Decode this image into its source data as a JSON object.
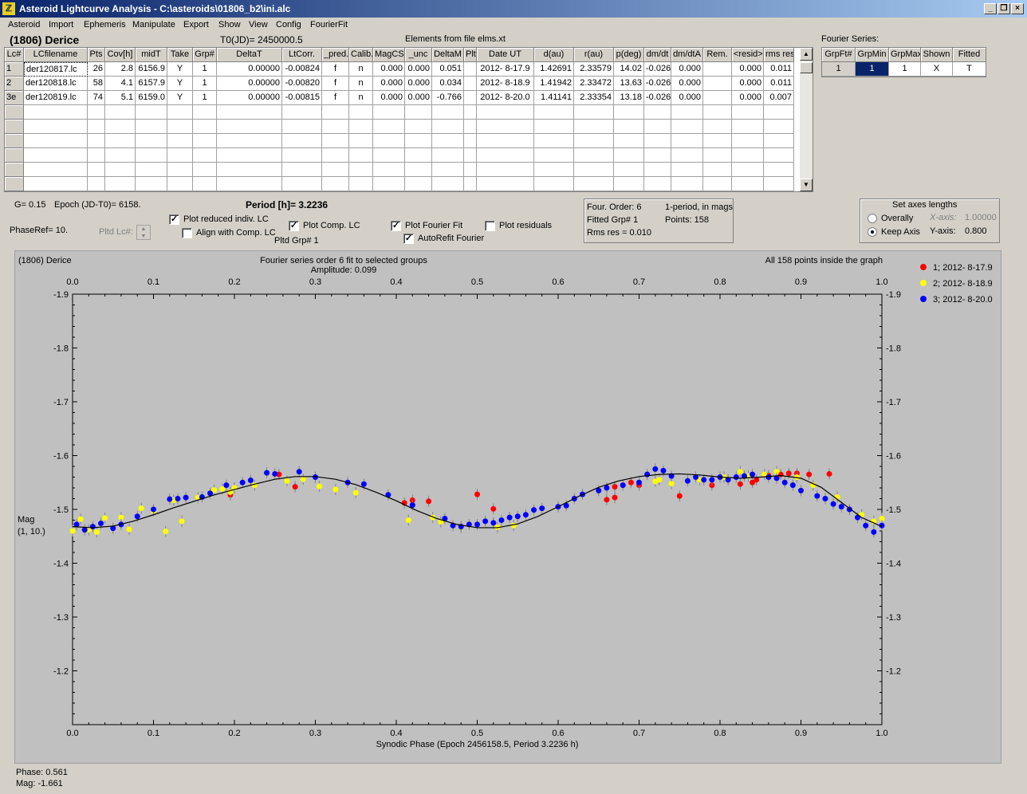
{
  "window": {
    "title": "Asteroid Lightcurve Analysis - C:\\asteroids\\01806_b2\\ini.alc",
    "icon_char": "ℤ"
  },
  "menu": [
    "Asteroid",
    "Import",
    "Ephemeris",
    "Manipulate",
    "Export",
    "Show",
    "View",
    "Config",
    "FourierFit"
  ],
  "header": {
    "asteroid": "(1806) Derice",
    "t0": "T0(JD)= 2450000.5",
    "elements": "Elements from file elms.xt",
    "fourier_series_label": "Fourier Series:"
  },
  "lc_table": {
    "columns": [
      "Lc#",
      "LCfilename",
      "Pts",
      "Cov[h]",
      "midT",
      "Take",
      "Grp#",
      "DeltaT",
      "LtCorr.",
      "_pred.",
      "Calib.",
      "MagCS",
      "_unc",
      "DeltaM",
      "Plt",
      "Date UT",
      "d(au)",
      "r(au)",
      "p(deg)",
      "dm/dt",
      "dm/dtA",
      "Rem.",
      "<resid>",
      "rms res"
    ],
    "rows": [
      [
        "1",
        "der120817.lc",
        "26",
        "2.8",
        "6156.9",
        "Y",
        "1",
        "0.00000",
        "-0.00824",
        "f",
        "n",
        "0.000",
        "0.000",
        "0.051",
        "",
        "2012- 8-17.9",
        "1.42691",
        "2.33579",
        "14.02",
        "-0.026",
        "0.000",
        "",
        "0.000",
        "0.011"
      ],
      [
        "2",
        "der120818.lc",
        "58",
        "4.1",
        "6157.9",
        "Y",
        "1",
        "0.00000",
        "-0.00820",
        "f",
        "n",
        "0.000",
        "0.000",
        "0.034",
        "",
        "2012- 8-18.9",
        "1.41942",
        "2.33472",
        "13.63",
        "-0.026",
        "0.000",
        "",
        "0.000",
        "0.011"
      ],
      [
        "3e",
        "der120819.lc",
        "74",
        "5.1",
        "6159.0",
        "Y",
        "1",
        "0.00000",
        "-0.00815",
        "f",
        "n",
        "0.000",
        "0.000",
        "-0.766",
        "",
        "2012- 8-20.0",
        "1.41141",
        "2.33354",
        "13.18",
        "-0.026",
        "0.000",
        "",
        "0.000",
        "0.007"
      ]
    ]
  },
  "fourier_table": {
    "columns": [
      "GrpFt#",
      "GrpMin",
      "GrpMax",
      "Shown",
      "Fitted"
    ],
    "rows": [
      [
        "1",
        "1",
        "1",
        "X",
        "T"
      ]
    ]
  },
  "controls": {
    "g": "G= 0.15",
    "epoch": "Epoch (JD-T0)= 6158.",
    "period": "Period [h]= 3.2236",
    "phaseref": "PhaseRef= 10.",
    "pltd_lc": "Pltd Lc#:",
    "plot_reduced": "Plot reduced indiv. LC",
    "align_comp": "Align with Comp. LC",
    "plot_comp": "Plot Comp. LC",
    "pltd_grp": "Pltd Grp#  1",
    "plot_fourier": "Plot Fourier Fit",
    "autorefit": "AutoRefit Fourier",
    "plot_residuals": "Plot residuals",
    "four_order": "Four. Order:  6",
    "one_period": "1-period, in mags",
    "fitted_grp": "Fitted Grp# 1",
    "points": "Points: 158",
    "rms_res": "Rms res      = 0.010",
    "set_axes": "Set axes lengths",
    "overally": "Overally",
    "keep_axis": "Keep Axis",
    "x_axis_label": "X-axis:",
    "x_axis_value": "1.00000",
    "y_axis_label": "Y-axis:",
    "y_axis_value": "0.800"
  },
  "plot_labels": {
    "name": "(1806) Derice",
    "subtitle": "Fourier series order 6 fit to selected groups",
    "amplitude": "Amplitude: 0.099",
    "inside": "All 158 points inside the graph",
    "ylabel1": "Mag",
    "ylabel2": "(1, 10.)"
  },
  "status": {
    "phase": "Phase:  0.561",
    "mag": "Mag:    -1.661"
  },
  "colors": {
    "red": "#ff0000",
    "yellow": "#ffff00",
    "blue": "#0000ff",
    "plot_bg": "#c0c0c0",
    "titlebar": "#0a246a"
  },
  "chart_data": {
    "type": "scatter",
    "xlabel": "Synodic Phase (Epoch 2456158.5, Period 3.2236 h)",
    "ylabel": "Mag",
    "xlim": [
      0,
      1
    ],
    "ylim": [
      -1.9,
      -1.1
    ],
    "x_ticks": [
      "0.0",
      "0.1",
      "0.2",
      "0.3",
      "0.4",
      "0.5",
      "0.6",
      "0.7",
      "0.8",
      "0.9",
      "1.0"
    ],
    "y_ticks": [
      "-1.9",
      "-1.8",
      "-1.7",
      "-1.6",
      "-1.5",
      "-1.4",
      "-1.3",
      "-1.2"
    ],
    "series": [
      {
        "name": "1; 2012- 8-17.9",
        "color": "#ff0000",
        "x": [
          0.195,
          0.255,
          0.275,
          0.41,
          0.42,
          0.44,
          0.5,
          0.52,
          0.66,
          0.67,
          0.67,
          0.69,
          0.7,
          0.75,
          0.79,
          0.825,
          0.84,
          0.845,
          0.86,
          0.875,
          0.885,
          0.895,
          0.91,
          0.935
        ],
        "y": [
          -1.527,
          -1.565,
          -1.542,
          -1.512,
          -1.517,
          -1.515,
          -1.528,
          -1.501,
          -1.518,
          -1.522,
          -1.542,
          -1.55,
          -1.545,
          -1.525,
          -1.545,
          -1.547,
          -1.55,
          -1.555,
          -1.563,
          -1.565,
          -1.567,
          -1.567,
          -1.565,
          -1.566
        ]
      },
      {
        "name": "2; 2012- 8-18.9",
        "color": "#ffff00",
        "x": [
          0.0,
          0.01,
          0.02,
          0.03,
          0.04,
          0.06,
          0.07,
          0.085,
          0.1,
          0.115,
          0.125,
          0.135,
          0.155,
          0.175,
          0.185,
          0.195,
          0.2,
          0.225,
          0.265,
          0.285,
          0.305,
          0.325,
          0.35,
          0.415,
          0.445,
          0.455,
          0.48,
          0.525,
          0.545,
          0.72,
          0.725,
          0.74,
          0.775,
          0.805,
          0.825,
          0.835,
          0.855,
          0.87,
          0.895,
          0.915,
          0.945,
          0.975,
          0.99,
          1.0
        ],
        "y": [
          -1.46,
          -1.482,
          -1.462,
          -1.458,
          -1.484,
          -1.485,
          -1.463,
          -1.502,
          -1.497,
          -1.459,
          -1.517,
          -1.478,
          -1.522,
          -1.536,
          -1.538,
          -1.532,
          -1.54,
          -1.545,
          -1.553,
          -1.556,
          -1.543,
          -1.537,
          -1.531,
          -1.48,
          -1.485,
          -1.477,
          -1.467,
          -1.467,
          -1.47,
          -1.552,
          -1.555,
          -1.548,
          -1.555,
          -1.56,
          -1.57,
          -1.562,
          -1.565,
          -1.57,
          -1.56,
          -1.545,
          -1.523,
          -1.49,
          -1.478,
          -1.483
        ]
      },
      {
        "name": "3; 2012- 8-20.0",
        "color": "#0000ff",
        "x": [
          0.005,
          0.015,
          0.025,
          0.035,
          0.05,
          0.06,
          0.08,
          0.1,
          0.12,
          0.13,
          0.14,
          0.16,
          0.17,
          0.19,
          0.21,
          0.22,
          0.24,
          0.25,
          0.28,
          0.3,
          0.34,
          0.36,
          0.39,
          0.42,
          0.46,
          0.47,
          0.48,
          0.49,
          0.5,
          0.51,
          0.52,
          0.53,
          0.54,
          0.55,
          0.56,
          0.57,
          0.58,
          0.6,
          0.61,
          0.62,
          0.63,
          0.65,
          0.66,
          0.68,
          0.7,
          0.71,
          0.72,
          0.73,
          0.74,
          0.76,
          0.77,
          0.78,
          0.79,
          0.8,
          0.81,
          0.82,
          0.83,
          0.84,
          0.86,
          0.87,
          0.88,
          0.89,
          0.9,
          0.92,
          0.93,
          0.94,
          0.95,
          0.96,
          0.97,
          0.98,
          0.99,
          1.0
        ],
        "y": [
          -1.472,
          -1.462,
          -1.468,
          -1.474,
          -1.465,
          -1.472,
          -1.487,
          -1.5,
          -1.519,
          -1.52,
          -1.522,
          -1.523,
          -1.53,
          -1.545,
          -1.55,
          -1.554,
          -1.568,
          -1.566,
          -1.57,
          -1.56,
          -1.55,
          -1.547,
          -1.527,
          -1.508,
          -1.483,
          -1.47,
          -1.468,
          -1.472,
          -1.472,
          -1.478,
          -1.475,
          -1.48,
          -1.485,
          -1.487,
          -1.49,
          -1.499,
          -1.502,
          -1.505,
          -1.507,
          -1.52,
          -1.528,
          -1.535,
          -1.54,
          -1.545,
          -1.55,
          -1.565,
          -1.575,
          -1.572,
          -1.562,
          -1.553,
          -1.56,
          -1.555,
          -1.555,
          -1.56,
          -1.555,
          -1.56,
          -1.562,
          -1.565,
          -1.56,
          -1.558,
          -1.55,
          -1.545,
          -1.535,
          -1.525,
          -1.52,
          -1.51,
          -1.505,
          -1.5,
          -1.485,
          -1.47,
          -1.458,
          -1.47
        ]
      },
      {
        "name": "Fourier fit",
        "color": "#000000",
        "x": [
          0.0,
          0.025,
          0.05,
          0.075,
          0.1,
          0.125,
          0.15,
          0.175,
          0.2,
          0.225,
          0.25,
          0.275,
          0.3,
          0.325,
          0.35,
          0.375,
          0.4,
          0.425,
          0.45,
          0.475,
          0.5,
          0.525,
          0.55,
          0.575,
          0.6,
          0.625,
          0.65,
          0.675,
          0.7,
          0.725,
          0.75,
          0.775,
          0.8,
          0.825,
          0.85,
          0.875,
          0.9,
          0.925,
          0.95,
          0.975,
          1.0
        ],
        "y": [
          -1.468,
          -1.466,
          -1.469,
          -1.478,
          -1.49,
          -1.503,
          -1.515,
          -1.527,
          -1.537,
          -1.547,
          -1.556,
          -1.561,
          -1.561,
          -1.556,
          -1.546,
          -1.532,
          -1.516,
          -1.498,
          -1.483,
          -1.472,
          -1.466,
          -1.466,
          -1.473,
          -1.487,
          -1.505,
          -1.524,
          -1.541,
          -1.553,
          -1.561,
          -1.565,
          -1.566,
          -1.564,
          -1.56,
          -1.558,
          -1.56,
          -1.563,
          -1.558,
          -1.541,
          -1.513,
          -1.485,
          -1.468
        ]
      }
    ]
  }
}
